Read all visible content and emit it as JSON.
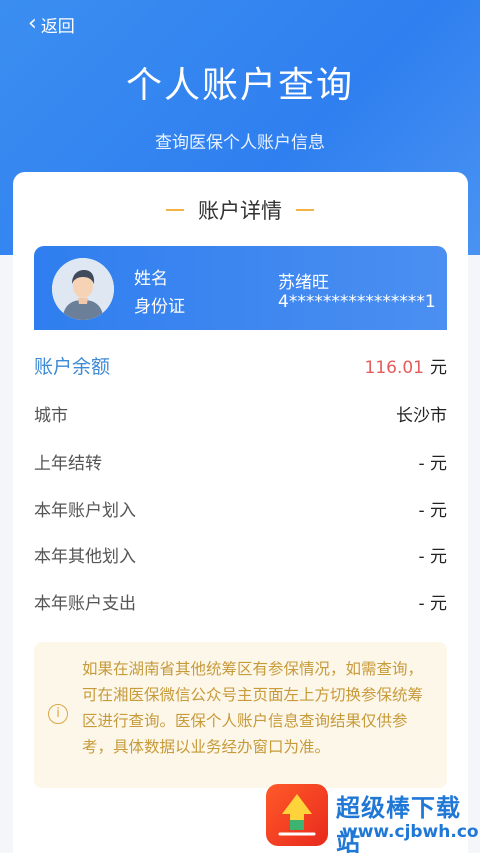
{
  "nav": {
    "back_label": "返回"
  },
  "header": {
    "title": "个人账户查询",
    "subtitle": "查询医保个人账户信息"
  },
  "section": {
    "title": "账户详情"
  },
  "user": {
    "name_label": "姓名",
    "name_value": "苏绪旺",
    "id_label": "身份证",
    "id_value": "4****************1"
  },
  "balance": {
    "label": "账户余额",
    "amount": "116.01",
    "unit": "元"
  },
  "rows": [
    {
      "label": "城市",
      "value": "长沙市"
    },
    {
      "label": "上年结转",
      "value": "- 元"
    },
    {
      "label": "本年账户划入",
      "value": "- 元"
    },
    {
      "label": "本年其他划入",
      "value": "- 元"
    },
    {
      "label": "本年账户支出",
      "value": "- 元"
    }
  ],
  "notice": {
    "icon": "info-icon",
    "text": "如果在湖南省其他统筹区有参保情况，如需查询，可在湘医保微信公众号主页面左上方切换参保统筹区进行查询。医保个人账户信息查询结果仅供参考，具体数据以业务经办窗口为准。"
  },
  "watermark": {
    "name": "超级棒下载站",
    "url": "www.cjbwh.com"
  },
  "colors": {
    "primary": "#2f7ff0",
    "accent": "#f3b443",
    "amount": "#e45d5d",
    "notice_bg": "#fdf7e9",
    "notice_text": "#c79a3a"
  }
}
